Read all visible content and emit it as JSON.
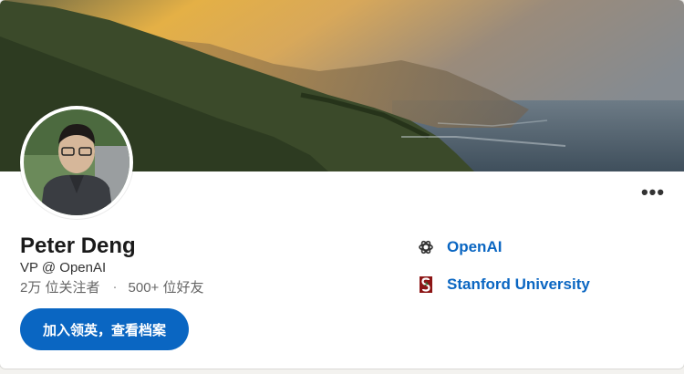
{
  "profile": {
    "name": "Peter Deng",
    "headline": "VP @ OpenAI",
    "followers": "2万 位关注者",
    "separator": "·",
    "connections": "500+ 位好友",
    "join_button": "加入领英，查看档案",
    "more_label": "•••"
  },
  "organizations": [
    {
      "name": "OpenAI",
      "icon": "openai-logo-icon"
    },
    {
      "name": "Stanford University",
      "icon": "stanford-logo-icon"
    }
  ],
  "colors": {
    "primary_blue": "#0a66c2",
    "stanford_red": "#8c1515"
  }
}
